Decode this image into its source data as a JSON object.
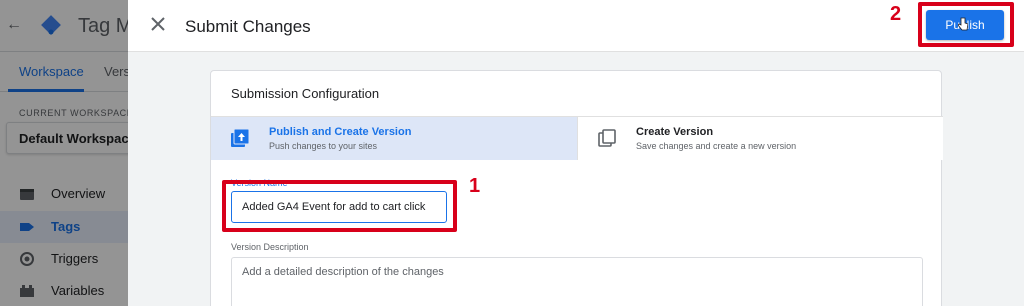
{
  "background_app": {
    "app_name": "Tag Ma",
    "tabs": [
      "Workspace",
      "Vers"
    ],
    "current_workspace_label": "CURRENT WORKSPACE",
    "workspace_name": "Default Workspace",
    "nav_items": [
      {
        "label": "Overview",
        "icon": "overview-icon",
        "active": false
      },
      {
        "label": "Tags",
        "icon": "tag-icon",
        "active": true
      },
      {
        "label": "Triggers",
        "icon": "trigger-icon",
        "active": false
      },
      {
        "label": "Variables",
        "icon": "variables-icon",
        "active": false
      }
    ]
  },
  "dialog": {
    "title": "Submit Changes",
    "publish_label": "Publish",
    "card_title": "Submission Configuration",
    "options": [
      {
        "title": "Publish and Create Version",
        "subtitle": "Push changes to your sites",
        "selected": true
      },
      {
        "title": "Create Version",
        "subtitle": "Save changes and create a new version",
        "selected": false
      }
    ],
    "version_name": {
      "label": "Version Name",
      "value": "Added GA4 Event for add to cart click"
    },
    "version_description": {
      "label": "Version Description",
      "placeholder": "Add a detailed description of the changes"
    }
  },
  "annotations": {
    "step_1": "1",
    "step_2": "2",
    "highlight_color": "#d8001a"
  },
  "colors": {
    "accent": "#1a73e8",
    "selected_option_bg": "#dde6f7"
  }
}
